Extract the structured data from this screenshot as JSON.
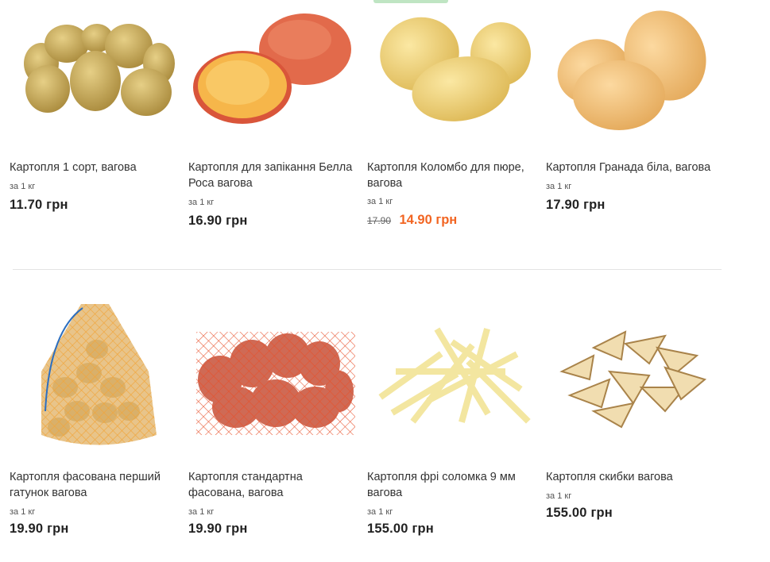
{
  "products_row_1": [
    {
      "name": "Картопля 1 сорт, вагова",
      "unit": "за 1 кг",
      "price": "11.70 грн",
      "image_icon": "potatoes-pile-icon"
    },
    {
      "name": "Картопля для запікання Белла Роса вагова",
      "unit": "за 1 кг",
      "price": "16.90 грн",
      "image_icon": "red-potato-halved-icon"
    },
    {
      "name": "Картопля Коломбо для пюре, вагова",
      "unit": "за 1 кг",
      "old_price": "17.90",
      "price": "14.90 грн",
      "image_icon": "yellow-potatoes-icon"
    },
    {
      "name": "Картопля Гранада біла, вагова",
      "unit": "за 1 кг",
      "price": "17.90 грн",
      "image_icon": "light-potatoes-icon"
    }
  ],
  "products_row_2": [
    {
      "name": "Картопля фасована перший гатунок вагова",
      "unit": "за 1 кг",
      "price": "19.90 грн",
      "image_icon": "potato-mesh-bag-icon"
    },
    {
      "name": "Картопля стандартна фасована, вагова",
      "unit": "за 1 кг",
      "price": "19.90 грн",
      "image_icon": "red-potato-mesh-bag-icon"
    },
    {
      "name": "Картопля фрі соломка 9 мм вагова",
      "unit": "за 1 кг",
      "price": "155.00 грн",
      "image_icon": "french-fries-icon"
    },
    {
      "name": "Картопля скибки вагова",
      "unit": "за 1 кг",
      "price": "155.00 грн",
      "image_icon": "potato-wedges-icon"
    }
  ],
  "colors": {
    "sale": "#f26522",
    "accent": "#bfe5c3",
    "text": "#2b2b2b"
  }
}
